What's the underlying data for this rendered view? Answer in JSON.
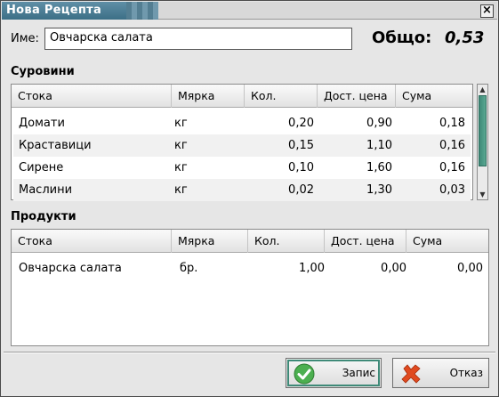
{
  "window": {
    "title": "Нова Рецепта",
    "close_icon": "close-icon"
  },
  "name": {
    "label": "Име:",
    "value": "Овчарска салата"
  },
  "total": {
    "label": "Общо:",
    "value": "0,53"
  },
  "ingredients": {
    "title": "Суровини",
    "columns": [
      "Стока",
      "Мярка",
      "Кол.",
      "Дост. цена",
      "Сума"
    ],
    "rows": [
      [
        "Домати",
        "кг",
        "0,20",
        "0,90",
        "0,18"
      ],
      [
        "Краставици",
        "кг",
        "0,15",
        "1,10",
        "0,16"
      ],
      [
        "Сирене",
        "кг",
        "0,10",
        "1,60",
        "0,16"
      ],
      [
        "Маслини",
        "кг",
        "0,02",
        "1,30",
        "0,03"
      ]
    ]
  },
  "products": {
    "title": "Продукти",
    "columns": [
      "Стока",
      "Мярка",
      "Кол.",
      "Дост. цена",
      "Сума"
    ],
    "rows": [
      [
        "Овчарска салата",
        "бр.",
        "1,00",
        "0,00",
        "0,00"
      ]
    ]
  },
  "buttons": {
    "save": {
      "label": "Запис",
      "icon": "checkmark-icon",
      "color": "#4caf50"
    },
    "cancel": {
      "label": "Отказ",
      "icon": "cross-icon",
      "color": "#e04a1f"
    }
  },
  "colors": {
    "titlebar": "#3c6f86",
    "scroll_thumb": "#3f8a78"
  }
}
